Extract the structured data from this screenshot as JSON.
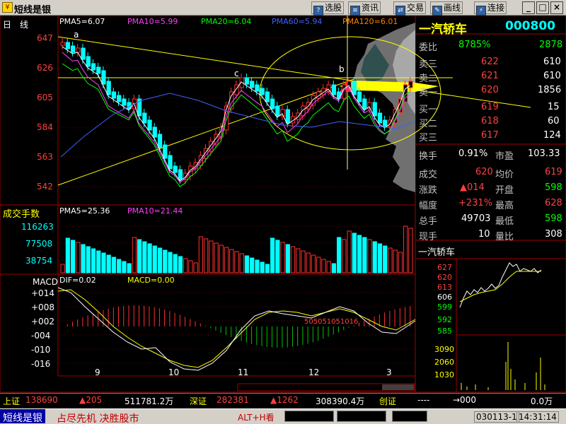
{
  "window": {
    "title": "短线是银",
    "toolbar": [
      "选股",
      "资讯",
      "交易",
      "画线",
      "连接"
    ],
    "controls": [
      "_",
      "□",
      "×"
    ]
  },
  "chart": {
    "period_label": "日　线",
    "ma_labels": [
      "PMA5=6.07",
      "PMA10=5.99",
      "PMA20=6.04",
      "PMA60=5.94",
      "PMA120=6.01"
    ],
    "price_ticks": [
      "647",
      "626",
      "605",
      "584",
      "563",
      "542"
    ],
    "annotations": [
      "a",
      "b",
      "c"
    ],
    "volume_title": "成交手数",
    "volume_ma_labels": [
      "PMA5=25.36",
      "PMA10=21.44"
    ],
    "volume_ticks": [
      "116263",
      "77508",
      "38754"
    ],
    "macd_title": "MACD",
    "macd_labels": [
      "DIF=0.02",
      "MACD=0.00"
    ],
    "macd_ticks": [
      "+014",
      "+008",
      "+002",
      "-004",
      "-010",
      "-016"
    ],
    "month_ticks": [
      "9",
      "10",
      "11",
      "12",
      "3"
    ],
    "macd_digits": "505051051016."
  },
  "quote": {
    "stock_name": "一汽轿车",
    "stock_code": "000800",
    "webi_label": "委比",
    "webi_value": "8785%",
    "webi_diff": "2878",
    "asks": [
      {
        "label": "卖三",
        "price": "622",
        "vol": "610"
      },
      {
        "label": "卖二",
        "price": "621",
        "vol": "610"
      },
      {
        "label": "卖一",
        "price": "620",
        "vol": "1856"
      }
    ],
    "bids": [
      {
        "label": "买一",
        "price": "619",
        "vol": "15"
      },
      {
        "label": "买二",
        "price": "618",
        "vol": "60"
      },
      {
        "label": "买三",
        "price": "617",
        "vol": "124"
      }
    ],
    "turnover_label": "换手",
    "turnover_value": "0.91%",
    "pe_label": "市盈",
    "pe_value": "103.33",
    "stats": [
      {
        "l1": "成交",
        "v1": "620",
        "l2": "均价",
        "v2": "619"
      },
      {
        "l1": "涨跌",
        "v1": "▲014",
        "l2": "开盘",
        "v2": "598"
      },
      {
        "l1": "幅度",
        "v1": "+231%",
        "l2": "最高",
        "v2": "628"
      },
      {
        "l1": "总手",
        "v1": "49703",
        "l2": "最低",
        "v2": "598"
      },
      {
        "l1": "现手",
        "v1": "10",
        "l2": "量比",
        "v2": "308"
      }
    ],
    "intraday_title": "一汽轿车",
    "intraday_price_ticks": [
      "627",
      "620",
      "613",
      "606",
      "599",
      "592",
      "585"
    ],
    "intraday_vol_ticks": [
      "3090",
      "2060",
      "1030"
    ]
  },
  "status": {
    "sh_label": "上证",
    "sh_value": "138690",
    "sh_change": "▲205",
    "sh_amount": "511781.2万",
    "sz_label": "深证",
    "sz_value": "282381",
    "sz_change": "▲1262",
    "sz_amount": "308390.4万",
    "cy_label": "创证",
    "cy_value": "----",
    "cy_change": "→000",
    "cy_amount": "0.0万"
  },
  "bottom": {
    "brand": "短线是银",
    "slogan": "占尽先机 决胜股市",
    "shortcut": "ALT+H看",
    "date_code": "030113-1",
    "time": "14:31:14"
  }
}
